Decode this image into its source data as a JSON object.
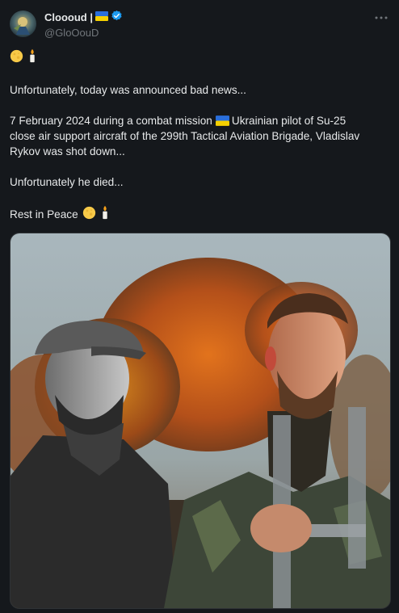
{
  "author": {
    "display_name": "Cloooud |",
    "handle": "@GloOouD"
  },
  "tweet": {
    "emoji_line": "🌕 🕯",
    "paragraph1": "Unfortunately, today was announced bad news...",
    "p2_line1_a": "7 February 2024 during a combat mission",
    "p2_line1_b": "Ukrainian pilot of Su-25",
    "p2_line2": "close air support aircraft of the 299th Tactical Aviation Brigade, Vladislav",
    "p2_line3": "Rykov was shot down...",
    "paragraph3": "Unfortunately he died...",
    "rest_in_peace": "Rest in Peace"
  },
  "colors": {
    "background": "#15181c",
    "text": "#e7e9ea",
    "secondary_text": "#71767b",
    "verified_badge": "#1d9bf0",
    "flag_blue": "#2a6fdb",
    "flag_yellow": "#f5d000"
  },
  "icons": [
    "ukraine-flag-icon",
    "verified-badge-icon",
    "more-options-icon",
    "full-moon-icon",
    "candle-icon"
  ]
}
